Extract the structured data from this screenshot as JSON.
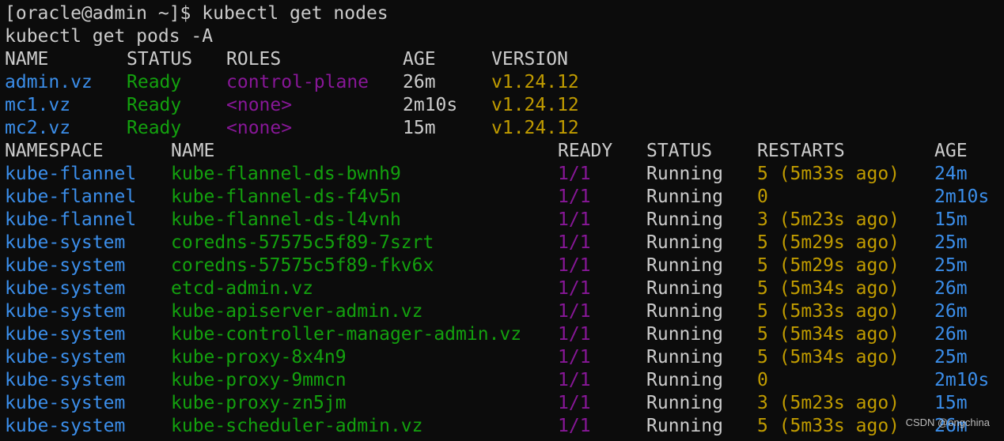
{
  "terminal": {
    "prompt_line": "[oracle@admin ~]$ kubectl get nodes",
    "second_command": "kubectl get pods -A"
  },
  "nodes_table": {
    "headers": [
      "NAME",
      "STATUS",
      "ROLES",
      "AGE",
      "VERSION"
    ],
    "rows": [
      [
        "admin.vz",
        "Ready",
        "control-plane",
        "26m",
        "v1.24.12"
      ],
      [
        "mc1.vz",
        "Ready",
        "<none>",
        "2m10s",
        "v1.24.12"
      ],
      [
        "mc2.vz",
        "Ready",
        "<none>",
        "15m",
        "v1.24.12"
      ]
    ]
  },
  "pods_table": {
    "headers": [
      "NAMESPACE",
      "NAME",
      "READY",
      "STATUS",
      "RESTARTS",
      "AGE"
    ],
    "rows": [
      [
        "kube-flannel",
        "kube-flannel-ds-bwnh9",
        "1/1",
        "Running",
        "5 (5m33s ago)",
        "24m"
      ],
      [
        "kube-flannel",
        "kube-flannel-ds-f4v5n",
        "1/1",
        "Running",
        "0",
        "2m10s"
      ],
      [
        "kube-flannel",
        "kube-flannel-ds-l4vnh",
        "1/1",
        "Running",
        "3 (5m23s ago)",
        "15m"
      ],
      [
        "kube-system",
        "coredns-57575c5f89-7szrt",
        "1/1",
        "Running",
        "5 (5m29s ago)",
        "25m"
      ],
      [
        "kube-system",
        "coredns-57575c5f89-fkv6x",
        "1/1",
        "Running",
        "5 (5m29s ago)",
        "25m"
      ],
      [
        "kube-system",
        "etcd-admin.vz",
        "1/1",
        "Running",
        "5 (5m34s ago)",
        "26m"
      ],
      [
        "kube-system",
        "kube-apiserver-admin.vz",
        "1/1",
        "Running",
        "5 (5m33s ago)",
        "26m"
      ],
      [
        "kube-system",
        "kube-controller-manager-admin.vz",
        "1/1",
        "Running",
        "5 (5m34s ago)",
        "26m"
      ],
      [
        "kube-system",
        "kube-proxy-8x4n9",
        "1/1",
        "Running",
        "5 (5m34s ago)",
        "25m"
      ],
      [
        "kube-system",
        "kube-proxy-9mmcn",
        "1/1",
        "Running",
        "0",
        "2m10s"
      ],
      [
        "kube-system",
        "kube-proxy-zn5jm",
        "1/1",
        "Running",
        "3 (5m23s ago)",
        "15m"
      ],
      [
        "kube-system",
        "kube-scheduler-admin.vz",
        "1/1",
        "Running",
        "5 (5m33s ago)",
        "26m"
      ]
    ]
  },
  "colors": {
    "background": "#0c0c0c",
    "default_text": "#cccccc",
    "blue": "#3b8eea",
    "green": "#13a10e",
    "purple": "#881798",
    "yellow": "#c19c00"
  },
  "watermark": "CSDN @ongchina"
}
